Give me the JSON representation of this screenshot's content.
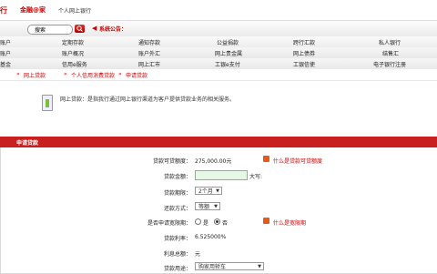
{
  "header": {
    "logo_left": "行",
    "brand": "金融@家",
    "subtitle": "个人网上银行"
  },
  "toolbar": {
    "search_label": "搜索",
    "notice_label": "系统公告："
  },
  "nav": {
    "row1": [
      "账户",
      "定期存款",
      "通知存款",
      "公益捐款",
      "跨行汇款",
      "私人银行"
    ],
    "row2": [
      "账户",
      "账户概况",
      "账户外汇",
      "网上贵金属",
      "网上债券",
      "结售汇"
    ],
    "row3": [
      "基金",
      "信用e服务",
      "网上汇市",
      "工银e支付",
      "工银信使",
      "电子银行注册"
    ]
  },
  "breadcrumb": [
    "网上贷款",
    "个人信用消费贷款",
    "申请贷款"
  ],
  "info": {
    "text": "网上贷款：是指我行通过网上银行渠道为客户提供贷款业务的相关服务。"
  },
  "section": {
    "title": "申请贷款"
  },
  "form": {
    "available_label": "贷款可贷额度：",
    "available_value": "275,000.00元",
    "available_tip": "什么是贷款可贷额度",
    "amount_label": "贷款金额：",
    "amount_value": "",
    "amount_suffix": "大写:",
    "term_label": "贷款期限：",
    "term_value": "2个月",
    "repay_label": "还款方式：",
    "repay_value": "等额",
    "grace_label": "是否申请宽限期：",
    "grace_yes": "是",
    "grace_no": "否",
    "grace_selected": "no",
    "grace_tip": "什么是宽限期",
    "rate_label": "贷款利率：",
    "rate_value": "6.525000%",
    "interest_label": "利息总额：",
    "interest_value": "元",
    "purpose_label": "贷款用途：",
    "purpose_value": "购家用轿车"
  }
}
